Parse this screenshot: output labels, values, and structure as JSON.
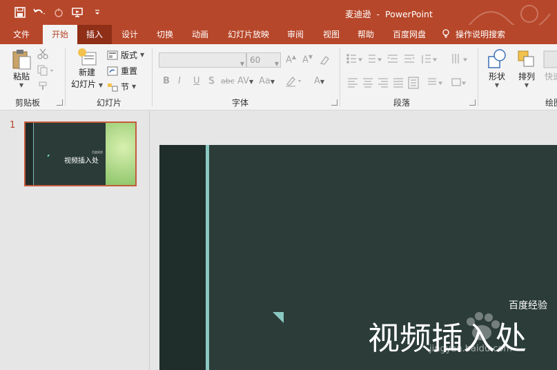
{
  "window": {
    "title_file": "麦迪逊",
    "title_sep": "-",
    "title_app": "PowerPoint"
  },
  "qat": {
    "save": "save-icon",
    "undo": "undo-icon",
    "redo": "redo-icon",
    "present": "presenter-icon",
    "customize": "customize-icon"
  },
  "tabs": [
    {
      "label": "文件"
    },
    {
      "label": "开始"
    },
    {
      "label": "插入"
    },
    {
      "label": "设计"
    },
    {
      "label": "切换"
    },
    {
      "label": "动画"
    },
    {
      "label": "幻灯片放映"
    },
    {
      "label": "审阅"
    },
    {
      "label": "视图"
    },
    {
      "label": "帮助"
    },
    {
      "label": "百度网盘"
    },
    {
      "label": "操作说明搜索"
    }
  ],
  "ribbon": {
    "clipboard": {
      "label": "剪贴板",
      "paste": "粘贴"
    },
    "slides": {
      "label": "幻灯片",
      "new_slide_1": "新建",
      "new_slide_2": "幻灯片",
      "layout": "版式",
      "reset": "重置",
      "section": "节"
    },
    "font": {
      "label": "字体",
      "font_name": "",
      "font_size": "60",
      "bold": "B",
      "italic": "I",
      "underline": "U",
      "shadow": "S",
      "strike": "abc",
      "spacing": "AV",
      "case": "Aa",
      "grow": "A",
      "shrink": "A",
      "color": "A"
    },
    "paragraph": {
      "label": "段落"
    },
    "drawing": {
      "label": "绘图",
      "shapes": "形状",
      "arrange": "排列",
      "quick": "快速"
    }
  },
  "slide_panel": {
    "number": "1",
    "thumb_title": "视频插入处",
    "thumb_subtitle": "百度经验"
  },
  "slide": {
    "subtitle": "百度经验",
    "title": "视频插入处"
  },
  "watermark": "jingyan.baidu.com",
  "colors": {
    "accent": "#b7472a",
    "slide_bg": "#2b3c39",
    "slide_accent": "#8ac8c2"
  }
}
